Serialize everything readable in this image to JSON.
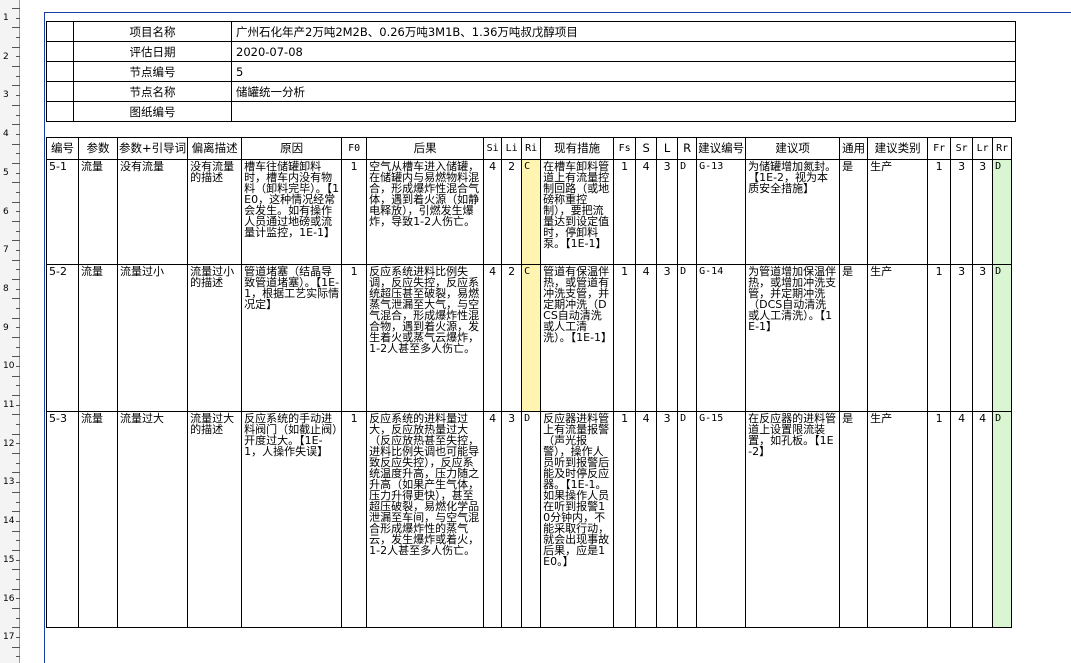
{
  "ruler": {
    "numbers": [
      "1",
      "2",
      "3",
      "4",
      "5",
      "6",
      "7",
      "8",
      "9",
      "10",
      "11",
      "12",
      "13",
      "14",
      "15",
      "16",
      "17"
    ]
  },
  "header": {
    "rows": [
      {
        "label": "项目名称",
        "value": "广州石化年产2万吨2M2B、0.26万吨3M1B、1.36万吨叔戊醇项目"
      },
      {
        "label": "评估日期",
        "value": "2020-07-08"
      },
      {
        "label": "节点编号",
        "value": "5"
      },
      {
        "label": "节点名称",
        "value": "储罐统一分析"
      },
      {
        "label": "图纸编号",
        "value": ""
      }
    ]
  },
  "table": {
    "columns": [
      "编号",
      "参数",
      "参数+引导词",
      "偏离描述",
      "原因",
      "F0",
      "后果",
      "Si",
      "Li",
      "Ri",
      "现有措施",
      "Fs",
      "S",
      "L",
      "R",
      "建议编号",
      "建议项",
      "通用",
      "建议类别",
      "Fr",
      "Sr",
      "Lr",
      "Rr"
    ],
    "rows": [
      {
        "id": "5-1",
        "param": "流量",
        "guide": "没有流量",
        "deviation": "没有流量的描述",
        "cause": "槽车往储罐卸料时，槽车内没有物料（卸料完毕）。【1E0，这种情况经常会发生。如有操作人员通过地磅或流量计监控，1E-1】",
        "f0": "1",
        "consequence": "空气从槽车进入储罐，在储罐内与易燃物料混合，形成爆炸性混合气体，遇到着火源（如静电释放），引燃发生爆炸，导致1-2人伤亡。",
        "si": "4",
        "li": "2",
        "ri": "C",
        "measures": "在槽车卸料管道上有流量控制回路（或地磅称重控制），要把流量达到设定值时，停卸料泵。【1E-1】",
        "fs": "1",
        "s": "4",
        "l": "3",
        "r": "D",
        "rec_no": "G-13",
        "rec": "为储罐增加氮封。【1E-2，视为本质安全措施】",
        "general": "是",
        "category": "生产",
        "fr": "1",
        "sr": "3",
        "lr": "3",
        "rr": "D"
      },
      {
        "id": "5-2",
        "param": "流量",
        "guide": "流量过小",
        "deviation": "流量过小的描述",
        "cause": "管道堵塞（结晶导致管道堵塞）。【1E-1，根据工艺实际情况定】",
        "f0": "1",
        "consequence": "反应系统进料比例失调，反应失控，反应系统超压甚至破裂，易燃蒸气泄漏至大气，与空气混合，形成爆炸性混合物，遇到着火源，发生着火或蒸气云爆炸，1-2人甚至多人伤亡。",
        "si": "4",
        "li": "2",
        "ri": "C",
        "measures": "管道有保温伴热，或管道有冲洗支管，并定期冲洗（DCS自动清洗或人工清洗）。【1E-1】",
        "fs": "1",
        "s": "4",
        "l": "3",
        "r": "D",
        "rec_no": "G-14",
        "rec": "为管道增加保温伴热，或增加冲洗支管，并定期冲洗（DCS自动清洗或人工清洗）。【1E-1】",
        "general": "是",
        "category": "生产",
        "fr": "1",
        "sr": "3",
        "lr": "3",
        "rr": "D"
      },
      {
        "id": "5-3",
        "param": "流量",
        "guide": "流量过大",
        "deviation": "流量过大的描述",
        "cause": "反应系统的手动进料阀门（如截止阀）开度过大。【1E-1，人操作失误】",
        "f0": "1",
        "consequence": "反应系统的进料量过大，反应放热量过大（反应放热甚至失控，进料比例失调也可能导致反应失控），反应系统温度升高，压力随之升高（如果产生气体，压力升得更快），甚至超压破裂，易燃化学品泄漏至车间，与空气混合形成爆炸性的蒸气云，发生爆炸或着火，1-2人甚至多人伤亡。",
        "si": "4",
        "li": "3",
        "ri": "D",
        "measures": "反应器进料管上有流量报警（声光报警），操作人员听到报警后能及时停反应器。【1E-1。如果操作人员在听到报警10分钟内，不能采取行动，就会出现事故后果，应是1E0。】",
        "fs": "1",
        "s": "4",
        "l": "3",
        "r": "D",
        "rec_no": "G-15",
        "rec": "在反应器的进料管道上设置限流装置，如孔板。【1E-2】",
        "general": "是",
        "category": "生产",
        "fr": "1",
        "sr": "4",
        "lr": "4",
        "rr": "D"
      }
    ]
  }
}
